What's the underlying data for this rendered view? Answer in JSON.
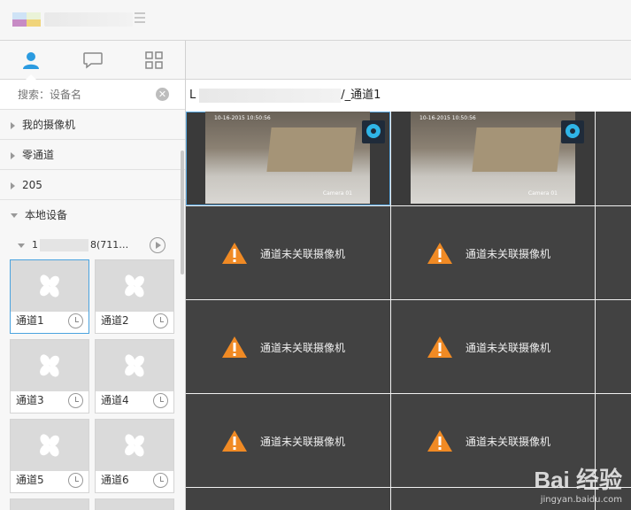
{
  "sidebar": {
    "tabs": [
      {
        "icon": "user-icon"
      },
      {
        "icon": "chat-icon"
      },
      {
        "icon": "grid-icon"
      }
    ],
    "search": {
      "placeholder": "搜索：设备名"
    },
    "tree": [
      {
        "label": "我的摄像机",
        "expanded": false
      },
      {
        "label": "零通道",
        "expanded": false
      },
      {
        "label": "205",
        "expanded": false
      },
      {
        "label": "本地设备",
        "expanded": true
      }
    ],
    "device": {
      "prefix": "1",
      "suffix": "8(711…"
    },
    "channels": [
      "通道1",
      "通道2",
      "通道3",
      "通道4",
      "通道5",
      "通道6"
    ]
  },
  "main": {
    "path": {
      "prefix": "L",
      "suffix": "/_通道1"
    },
    "feeds": [
      {
        "timestamp": "10-16-2015 10:50:56",
        "camera": "Camera 01"
      },
      {
        "timestamp": "10-16-2015 10:50:56",
        "camera": "Camera 01"
      }
    ],
    "no_camera_text": "通道未关联摄像机"
  },
  "watermark": {
    "brand": "Bai 经验",
    "sub": "jingyan.baidu.com"
  },
  "colors": {
    "accent": "#4aa3df",
    "warning": "#f08a24",
    "cell": "#424242"
  }
}
